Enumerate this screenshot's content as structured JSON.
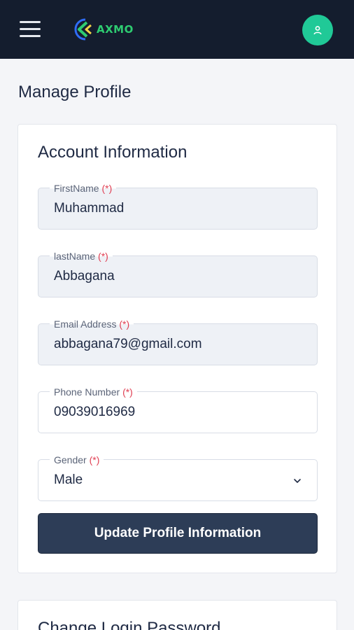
{
  "header": {
    "logo_text": "AXMO",
    "colors": {
      "bar": "#141d2e",
      "avatar": "#20c997",
      "logo_accent": "#2ecc71",
      "logo_blue": "#2f6cf6"
    }
  },
  "page": {
    "title": "Manage Profile"
  },
  "account": {
    "title": "Account Information",
    "fields": [
      {
        "label": "FirstName",
        "required_mark": "(*)",
        "value": "Muhammad"
      },
      {
        "label": "lastName",
        "required_mark": "(*)",
        "value": "Abbagana"
      },
      {
        "label": "Email Address",
        "required_mark": "(*)",
        "value": "abbagana79@gmail.com"
      },
      {
        "label": "Phone Number",
        "required_mark": "(*)",
        "value": "09039016969"
      },
      {
        "label": "Gender",
        "required_mark": "(*)",
        "value": "Male"
      }
    ],
    "submit_label": "Update Profile Information"
  },
  "password": {
    "title": "Change Login Password"
  }
}
